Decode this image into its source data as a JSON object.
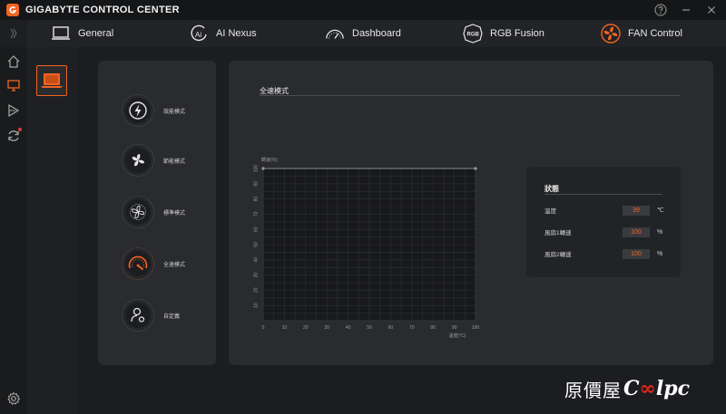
{
  "app": {
    "title": "GIGABYTE CONTROL CENTER"
  },
  "nav": {
    "tabs": [
      {
        "label": "General",
        "icon": "laptop-icon"
      },
      {
        "label": "AI Nexus",
        "icon": "ai-icon"
      },
      {
        "label": "Dashboard",
        "icon": "gauge-icon"
      },
      {
        "label": "RGB Fusion",
        "icon": "rgb-icon"
      },
      {
        "label": "FAN Control",
        "icon": "fan-icon"
      }
    ]
  },
  "modes": [
    {
      "label": "效能模式",
      "icon": "lightning-icon"
    },
    {
      "label": "節能模式",
      "icon": "fan-leaf-icon"
    },
    {
      "label": "標準模式",
      "icon": "fan-standard-icon"
    },
    {
      "label": "全速模式",
      "icon": "speedometer-icon"
    },
    {
      "label": "自定義",
      "icon": "user-custom-icon"
    }
  ],
  "main": {
    "title": "全速模式"
  },
  "chart_data": {
    "type": "line",
    "ylabel": "轉速(%)",
    "xlabel": "溫度(°C)",
    "x_ticks": [
      0,
      10,
      20,
      30,
      40,
      50,
      60,
      70,
      80,
      90,
      100
    ],
    "y_ticks": [
      10,
      20,
      30,
      40,
      50,
      60,
      70,
      80,
      90,
      100
    ],
    "xlim": [
      0,
      100
    ],
    "ylim": [
      0,
      100
    ],
    "grid": true,
    "series": [
      {
        "x": [
          0,
          100
        ],
        "y": [
          100,
          100
        ]
      }
    ]
  },
  "status": {
    "title": "狀態",
    "rows": [
      {
        "label": "溫度",
        "value": "39",
        "unit": "℃"
      },
      {
        "label": "風扇1轉速",
        "value": "100",
        "unit": "%"
      },
      {
        "label": "風扇2轉速",
        "value": "100",
        "unit": "%"
      }
    ]
  },
  "watermark": {
    "cn": "原價屋",
    "en_a": "C",
    "en_inf": "∞",
    "en_b": "lpc"
  },
  "colors": {
    "accent": "#f26522",
    "panel": "#2a2b2e",
    "bg": "#1c1d20"
  }
}
